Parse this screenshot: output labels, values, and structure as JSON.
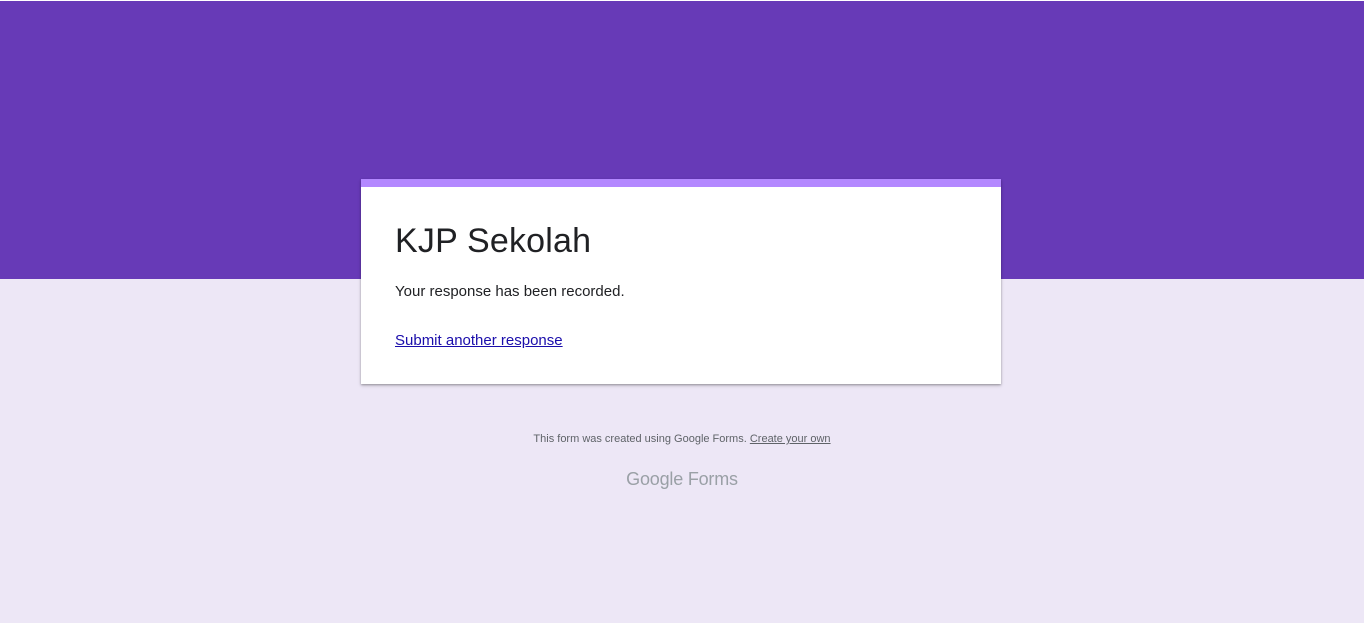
{
  "form": {
    "title": "KJP Sekolah",
    "confirmation": "Your response has been recorded.",
    "another_response_link": "Submit another response"
  },
  "footer": {
    "notice": "This form was created using Google Forms.",
    "create_link": "Create your own"
  },
  "branding": {
    "google": "Google",
    "forms": "Forms"
  },
  "colors": {
    "header_band": "#673ab7",
    "page_background": "#ede7f6",
    "card_accent": "#b388ff",
    "link": "#1a0dab"
  }
}
